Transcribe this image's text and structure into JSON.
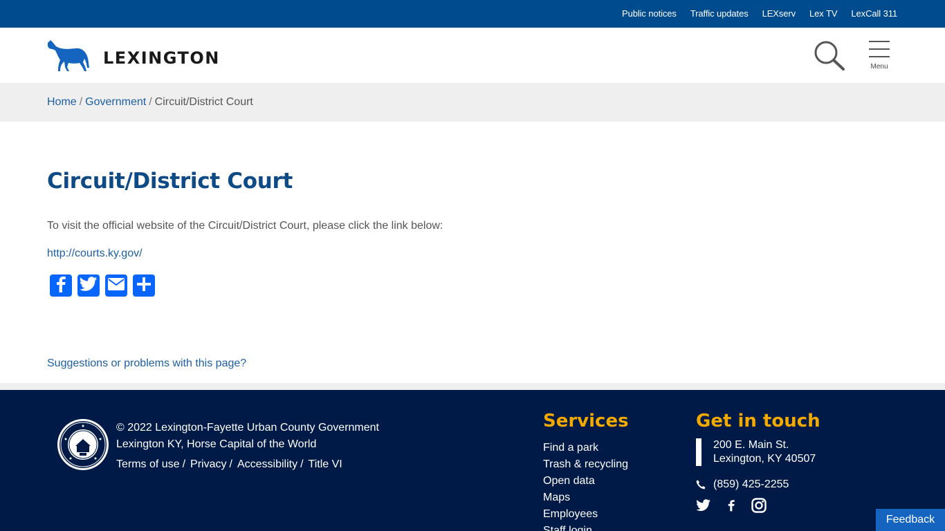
{
  "topbar": {
    "links": [
      "Public notices",
      "Traffic updates",
      "LEXserv",
      "Lex TV",
      "LexCall 311"
    ]
  },
  "header": {
    "logo_text": "LEXINGTON",
    "menu_label": "Menu",
    "icons": {
      "logo": "horse-icon",
      "search": "search-icon",
      "menu": "hamburger-icon"
    }
  },
  "breadcrumb": {
    "home": "Home",
    "sep": "/",
    "government": "Government",
    "current": "Circuit/District Court"
  },
  "main": {
    "title": "Circuit/District Court",
    "intro": "To visit the official website of the Circuit/District Court, please click the link below:",
    "link": "http://courts.ky.gov/",
    "share_icons": [
      "facebook-icon",
      "twitter-icon",
      "email-icon",
      "share-icon"
    ],
    "suggestion": "Suggestions or problems with this page?"
  },
  "footer": {
    "copyright_line1": "© 2022 Lexington-Fayette Urban County Government",
    "copyright_line2": "Lexington KY, Horse Capital of the World",
    "seal_icon": "county-seal-icon",
    "legal": {
      "terms": "Terms of use",
      "privacy": "Privacy",
      "accessibility": "Accessibility",
      "title6": "Title VI",
      "sep": "/"
    },
    "services": {
      "title": "Services",
      "items": [
        "Find a park",
        "Trash & recycling",
        "Open data",
        "Maps",
        "Employees",
        "Staff login"
      ]
    },
    "contact": {
      "title": "Get in touch",
      "address_line1": "200 E. Main St.",
      "address_line2": "Lexington, KY  40507",
      "phone": "(859) 425-2255",
      "social_icons": [
        "twitter-icon",
        "facebook-icon",
        "instagram-icon"
      ]
    }
  },
  "feedback": {
    "label": "Feedback"
  },
  "colors": {
    "topbar": "#004b8d",
    "footer": "#001a47",
    "accent": "#f2a900",
    "link": "#1d5fa3",
    "title": "#0e4a86"
  }
}
